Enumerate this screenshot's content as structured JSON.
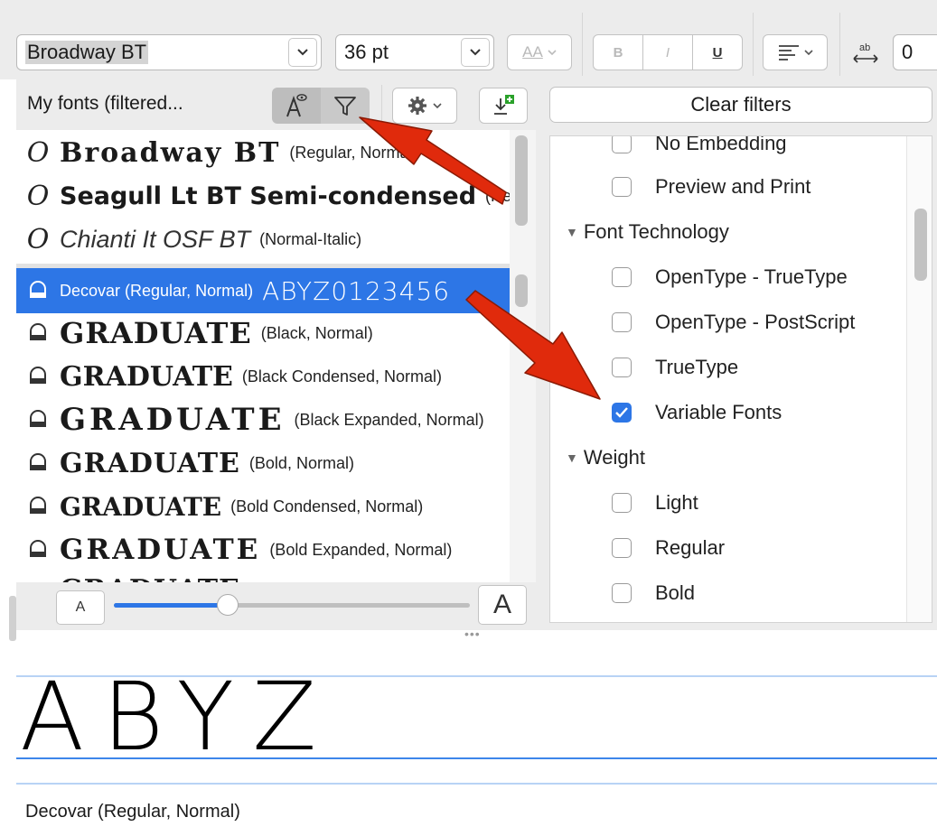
{
  "toolbar": {
    "font_name": "Broadway BT",
    "font_size": "36 pt",
    "case_label": "AA",
    "bold_label": "B",
    "italic_label": "I",
    "underline_label": "U",
    "spacing_value": "0"
  },
  "font_panel": {
    "header_label": "My fonts (filtered...",
    "fonts": [
      {
        "name": "Broadway BT",
        "style": "(Regular, Normal)",
        "icon": "opentype-icon"
      },
      {
        "name": "Seagull Lt BT Semi-condensed",
        "style": "(Regular, Normal)",
        "icon": "opentype-icon"
      },
      {
        "name": "Chianti It OSF BT",
        "style": "(Normal-Italic)",
        "icon": "opentype-icon"
      },
      {
        "name": "Decovar (Regular, Normal)",
        "style": "ABYZ0123456",
        "icon": "variable-font-icon",
        "selected": true
      },
      {
        "name": "GRADUATE",
        "style": "(Black, Normal)",
        "icon": "variable-font-icon"
      },
      {
        "name": "GRADUATE",
        "style": "(Black Condensed, Normal)",
        "icon": "variable-font-icon"
      },
      {
        "name": "GRADUATE",
        "style": "(Black Expanded, Normal)",
        "icon": "variable-font-icon"
      },
      {
        "name": "GRADUATE",
        "style": "(Bold, Normal)",
        "icon": "variable-font-icon"
      },
      {
        "name": "GRADUATE",
        "style": "(Bold Condensed, Normal)",
        "icon": "variable-font-icon"
      },
      {
        "name": "GRADUATE",
        "style": "(Bold Expanded, Normal)",
        "icon": "variable-font-icon"
      },
      {
        "name": "GRADUATE",
        "style": "",
        "icon": "variable-font-icon"
      }
    ],
    "size_slider": {
      "small_label": "A",
      "large_label": "A",
      "value_fraction": 0.32
    }
  },
  "filter_panel": {
    "clear_filters_label": "Clear filters",
    "items": [
      {
        "type": "option",
        "label": "No Embedding",
        "checked": false
      },
      {
        "type": "option",
        "label": "Preview and Print",
        "checked": false
      },
      {
        "type": "group",
        "label": "Font Technology"
      },
      {
        "type": "option",
        "label": "OpenType - TrueType",
        "checked": false
      },
      {
        "type": "option",
        "label": "OpenType - PostScript",
        "checked": false
      },
      {
        "type": "option",
        "label": "TrueType",
        "checked": false
      },
      {
        "type": "option",
        "label": "Variable Fonts",
        "checked": true
      },
      {
        "type": "group",
        "label": "Weight"
      },
      {
        "type": "option",
        "label": "Light",
        "checked": false
      },
      {
        "type": "option",
        "label": "Regular",
        "checked": false
      },
      {
        "type": "option",
        "label": "Bold",
        "checked": false
      }
    ]
  },
  "preview": {
    "text": "ABYZ",
    "caption": "Decovar (Regular, Normal)"
  },
  "colors": {
    "accent": "#2d76e6",
    "arrow": "#e02a0c",
    "toolbar_bg": "#ececec"
  }
}
